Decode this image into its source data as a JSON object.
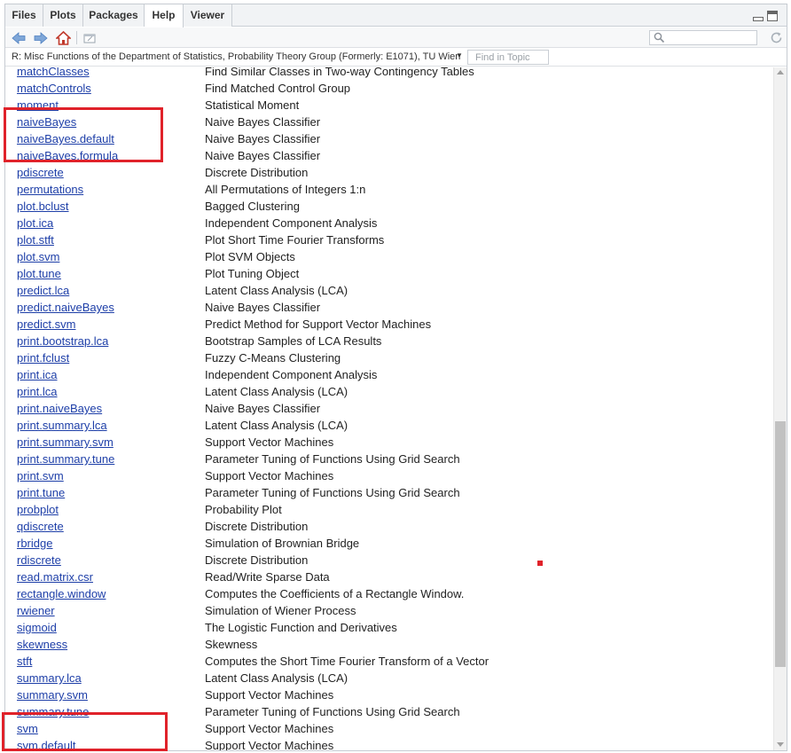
{
  "tabs": [
    {
      "label": "Files",
      "active": false
    },
    {
      "label": "Plots",
      "active": false
    },
    {
      "label": "Packages",
      "active": false
    },
    {
      "label": "Help",
      "active": true
    },
    {
      "label": "Viewer",
      "active": false
    }
  ],
  "toolbar": {
    "search_placeholder": ""
  },
  "topic": {
    "title": "R: Misc Functions of the Department of Statistics, Probability Theory Group (Formerly: E1071), TU Wien",
    "find_placeholder": "Find in Topic"
  },
  "colors": {
    "link": "#1e3fa8",
    "highlight": "#e0222a"
  },
  "rows": [
    {
      "name": "matchClasses",
      "desc": "Find Similar Classes in Two-way Contingency Tables"
    },
    {
      "name": "matchControls",
      "desc": "Find Matched Control Group"
    },
    {
      "name": "moment",
      "desc": "Statistical Moment"
    },
    {
      "name": "naiveBayes",
      "desc": "Naive Bayes Classifier"
    },
    {
      "name": "naiveBayes.default",
      "desc": "Naive Bayes Classifier"
    },
    {
      "name": "naiveBayes.formula",
      "desc": "Naive Bayes Classifier"
    },
    {
      "name": "pdiscrete",
      "desc": "Discrete Distribution"
    },
    {
      "name": "permutations",
      "desc": "All Permutations of Integers 1:n"
    },
    {
      "name": "plot.bclust",
      "desc": "Bagged Clustering"
    },
    {
      "name": "plot.ica",
      "desc": "Independent Component Analysis"
    },
    {
      "name": "plot.stft",
      "desc": "Plot Short Time Fourier Transforms"
    },
    {
      "name": "plot.svm",
      "desc": "Plot SVM Objects"
    },
    {
      "name": "plot.tune",
      "desc": "Plot Tuning Object"
    },
    {
      "name": "predict.lca",
      "desc": "Latent Class Analysis (LCA)"
    },
    {
      "name": "predict.naiveBayes",
      "desc": "Naive Bayes Classifier"
    },
    {
      "name": "predict.svm",
      "desc": "Predict Method for Support Vector Machines"
    },
    {
      "name": "print.bootstrap.lca",
      "desc": "Bootstrap Samples of LCA Results"
    },
    {
      "name": "print.fclust",
      "desc": "Fuzzy C-Means Clustering"
    },
    {
      "name": "print.ica",
      "desc": "Independent Component Analysis"
    },
    {
      "name": "print.lca",
      "desc": "Latent Class Analysis (LCA)"
    },
    {
      "name": "print.naiveBayes",
      "desc": "Naive Bayes Classifier"
    },
    {
      "name": "print.summary.lca",
      "desc": "Latent Class Analysis (LCA)"
    },
    {
      "name": "print.summary.svm",
      "desc": "Support Vector Machines"
    },
    {
      "name": "print.summary.tune",
      "desc": "Parameter Tuning of Functions Using Grid Search"
    },
    {
      "name": "print.svm",
      "desc": "Support Vector Machines"
    },
    {
      "name": "print.tune",
      "desc": "Parameter Tuning of Functions Using Grid Search"
    },
    {
      "name": "probplot",
      "desc": "Probability Plot"
    },
    {
      "name": "qdiscrete",
      "desc": "Discrete Distribution"
    },
    {
      "name": "rbridge",
      "desc": "Simulation of Brownian Bridge"
    },
    {
      "name": "rdiscrete",
      "desc": "Discrete Distribution"
    },
    {
      "name": "read.matrix.csr",
      "desc": "Read/Write Sparse Data"
    },
    {
      "name": "rectangle.window",
      "desc": "Computes the Coefficients of a Rectangle Window."
    },
    {
      "name": "rwiener",
      "desc": "Simulation of Wiener Process"
    },
    {
      "name": "sigmoid",
      "desc": "The Logistic Function and Derivatives"
    },
    {
      "name": "skewness",
      "desc": "Skewness"
    },
    {
      "name": "stft",
      "desc": "Computes the Short Time Fourier Transform of a Vector"
    },
    {
      "name": "summary.lca",
      "desc": "Latent Class Analysis (LCA)"
    },
    {
      "name": "summary.svm",
      "desc": "Support Vector Machines"
    },
    {
      "name": "summary.tune",
      "desc": "Parameter Tuning of Functions Using Grid Search"
    },
    {
      "name": "svm",
      "desc": "Support Vector Machines"
    },
    {
      "name": "svm.default",
      "desc": "Support Vector Machines"
    }
  ]
}
